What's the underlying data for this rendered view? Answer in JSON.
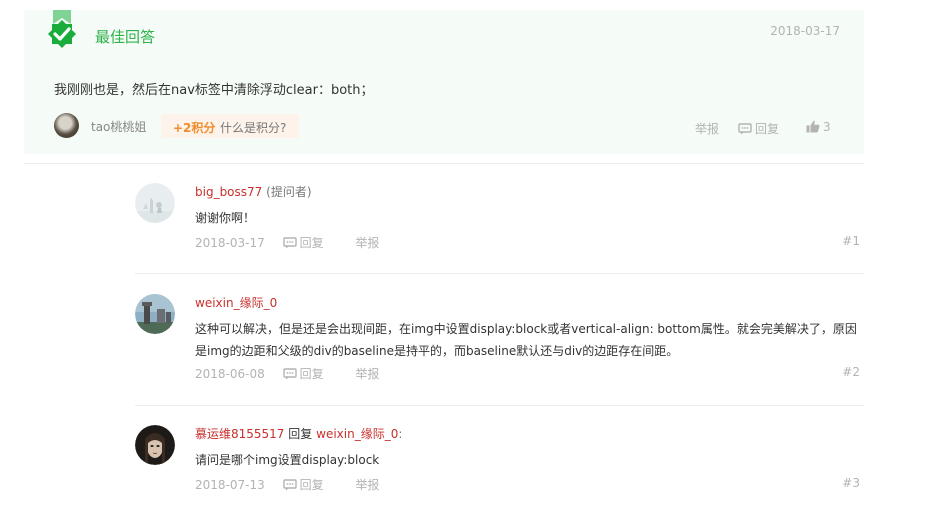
{
  "best_answer": {
    "title": "最佳回答",
    "date": "2018-03-17",
    "content": "我刚刚也是，然后在nav标签中清除浮动clear：both；",
    "author": "tao桃桃姐",
    "points": "+2积分",
    "points_help": "什么是积分?",
    "report_label": "举报",
    "reply_label": "回复",
    "like_count": "3"
  },
  "replies": [
    {
      "user": "big_boss77",
      "role": "(提问者)",
      "text": "谢谢你啊！",
      "date": "2018-03-17",
      "reply_label": "回复",
      "report_label": "举报",
      "floor": "#1"
    },
    {
      "user": "weixin_缘际_0",
      "text": "这种可以解决，但是还是会出现间距，在img中设置display:block或者vertical-align: bottom属性。就会完美解决了，原因是img的边距和父级的div的baseline是持平的，而baseline默认还与div的边距存在间距。",
      "date": "2018-06-08",
      "reply_label": "回复",
      "report_label": "举报",
      "floor": "#2"
    },
    {
      "user": "慕运维8155517",
      "reply_word": "回复",
      "reply_to": "weixin_缘际_0",
      "colon": ":",
      "text": "请问是哪个img设置display:block",
      "date": "2018-07-13",
      "reply_label": "回复",
      "report_label": "举报",
      "floor": "#3"
    }
  ],
  "colors": {
    "accent_green": "#2db34a",
    "username_red": "#c9302c",
    "points_orange": "#f08c2c",
    "best_bg": "#f5fbf6"
  }
}
